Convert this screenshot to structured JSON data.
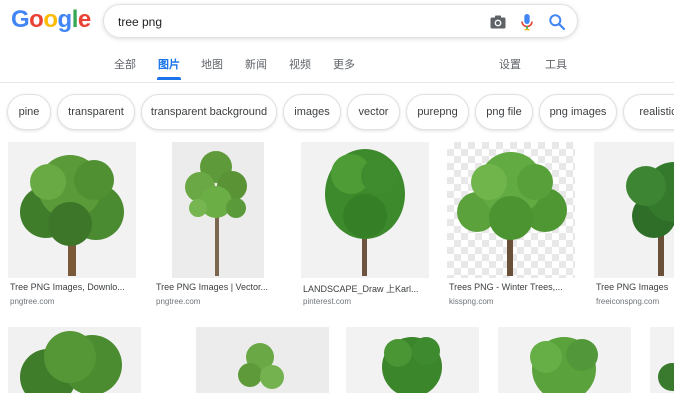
{
  "logo": {
    "letters": [
      "G",
      "o",
      "o",
      "g",
      "l",
      "e"
    ],
    "colors": [
      "#4285F4",
      "#EA4335",
      "#FBBC05",
      "#4285F4",
      "#34A853",
      "#EA4335"
    ]
  },
  "search": {
    "query": "tree png"
  },
  "icons": {
    "camera": "camera-icon",
    "mic": "microphone-icon",
    "search": "search-icon"
  },
  "nav": {
    "tabs": [
      {
        "label": "全部"
      },
      {
        "label": "图片"
      },
      {
        "label": "地图"
      },
      {
        "label": "新闻"
      },
      {
        "label": "视频"
      },
      {
        "label": "更多"
      }
    ],
    "settings": "设置",
    "tools": "工具",
    "accent": "#1a73e8"
  },
  "chips": [
    "pine",
    "transparent",
    "transparent background",
    "images",
    "vector",
    "purepng",
    "png file",
    "png images",
    "realistic"
  ],
  "results": [
    {
      "title": "Tree PNG Images, Downlo...",
      "source": "pngtree.com"
    },
    {
      "title": "Tree PNG Images | Vector...",
      "source": "pngtree.com"
    },
    {
      "title": "LANDSCAPE_Draw 上Karl...",
      "source": "pinterest.com"
    },
    {
      "title": "Trees PNG - Winter Trees,...",
      "source": "kisspng.com"
    },
    {
      "title": "Tree PNG Images",
      "source": "freeiconspng.com"
    }
  ]
}
